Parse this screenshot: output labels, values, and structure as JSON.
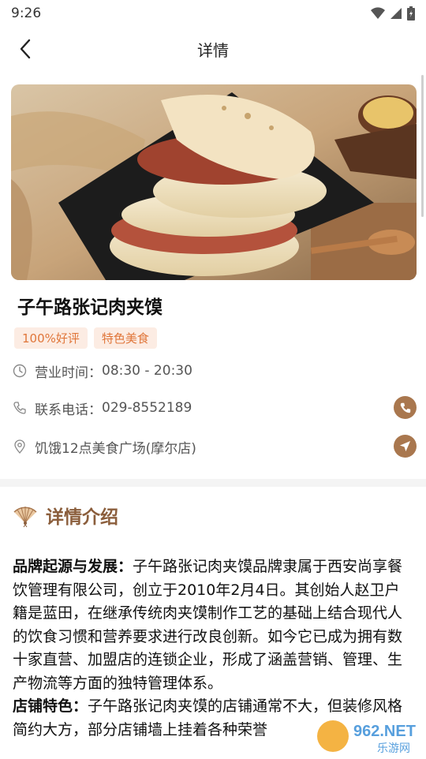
{
  "status_bar": {
    "time": "9:26"
  },
  "header": {
    "title": "详情"
  },
  "store": {
    "name": "子午路张记肉夹馍",
    "tags": [
      "100%好评",
      "特色美食"
    ],
    "hours_label": "营业时间：",
    "hours_value": "08:30 - 20:30",
    "phone_label": "联系电话：",
    "phone_value": "029-8552189",
    "address": "饥饿12点美食广场(摩尔店)"
  },
  "details": {
    "section_title": "详情介绍",
    "paragraphs": [
      {
        "heading": "品牌起源与发展：",
        "text": "子午路张记肉夹馍品牌隶属于西安尚享餐饮管理有限公司，创立于2010年2月4日。其创始人赵卫户籍是蓝田，在继承传统肉夹馍制作工艺的基础上结合现代人的饮食习惯和营养要求进行改良创新。如今它已成为拥有数十家直营、加盟店的连锁企业，形成了涵盖营销、管理、生产物流等方面的独特管理体系。"
      },
      {
        "heading": "店铺特色：",
        "text": "子午路张记肉夹馍的店铺通常不大，但装修风格简约大方，部分店铺墙上挂着各种荣誉"
      }
    ]
  },
  "watermark": {
    "brand": "962.NET",
    "sub": "乐游网"
  },
  "colors": {
    "accent": "#a9774e",
    "tag_text": "#e0763a",
    "tag_bg": "#fcece3",
    "section_title": "#8b5e3c"
  }
}
